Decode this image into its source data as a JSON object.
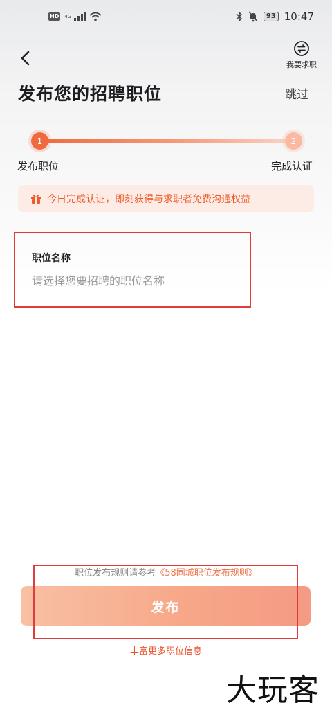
{
  "status_bar": {
    "hd_badge": "HD",
    "network_label": "4G",
    "battery": "93",
    "time": "10:47"
  },
  "header": {
    "switch_label": "我要求职",
    "title": "发布您的招聘职位",
    "skip": "跳过"
  },
  "stepper": {
    "steps": [
      {
        "number": "1",
        "label": "发布职位"
      },
      {
        "number": "2",
        "label": "完成认证"
      }
    ],
    "current_step": 1
  },
  "banner": {
    "icon": "gift-icon",
    "text": "今日完成认证，即刻获得与求职者免费沟通权益"
  },
  "form": {
    "job_title": {
      "label": "职位名称",
      "value": "",
      "placeholder": "请选择您要招聘的职位名称"
    }
  },
  "footer": {
    "rules_prefix": "职位发布规则请参考",
    "rules_link": "《58同城职位发布规则》",
    "publish_button": "发布",
    "more_info_link": "丰富更多职位信息"
  },
  "watermark": "大玩客",
  "colors": {
    "accent": "#f06a3f",
    "banner_bg": "#fdece5",
    "button_start": "#f9c0a4",
    "button_end": "#f59a84",
    "annotation_red": "#e23b3b"
  }
}
